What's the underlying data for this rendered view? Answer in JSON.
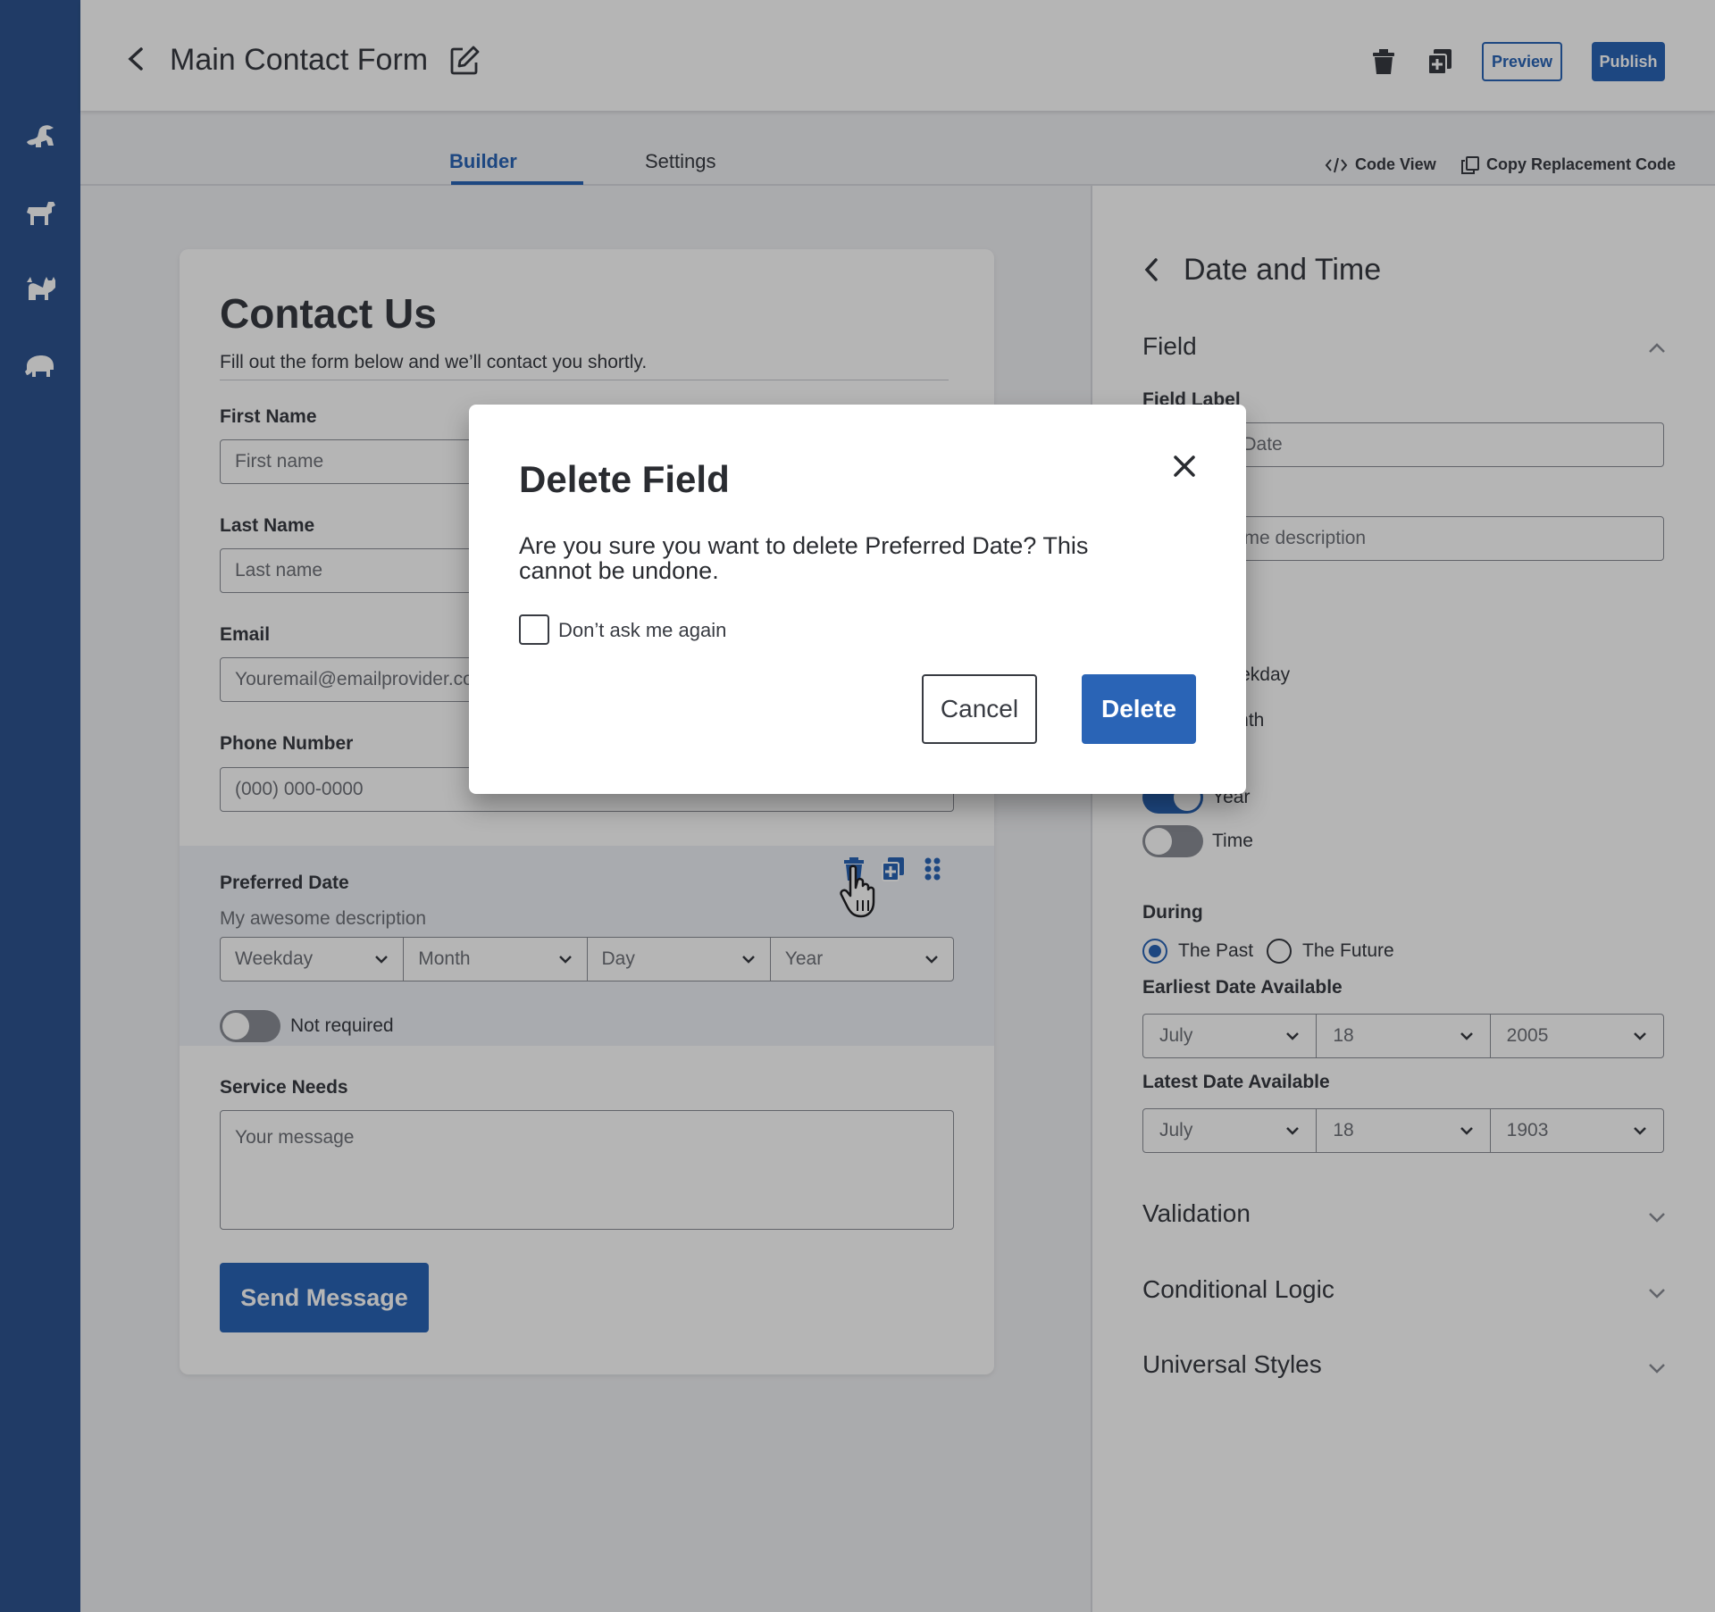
{
  "header": {
    "title": "Main Contact Form",
    "preview_label": "Preview",
    "publish_label": "Publish"
  },
  "tabs": [
    {
      "label": "Builder",
      "active": true
    },
    {
      "label": "Settings",
      "active": false
    }
  ],
  "toolbar": {
    "code_view_label": "Code View",
    "copy_code_label": "Copy Replacement Code"
  },
  "sidebar": {
    "icons": [
      "dinosaur-icon",
      "dog-icon",
      "cat-icon",
      "elephant-icon"
    ]
  },
  "form": {
    "title": "Contact Us",
    "subtitle": "Fill out the form below and we’ll contact you shortly.",
    "fields": [
      {
        "label": "First Name",
        "placeholder": "First name"
      },
      {
        "label": "Last Name",
        "placeholder": "Last name"
      },
      {
        "label": "Email",
        "placeholder": "Youremail@emailprovider.com"
      },
      {
        "label": "Phone Number",
        "placeholder": "(000) 000-0000"
      }
    ],
    "preferred_date": {
      "label": "Preferred Date",
      "description": "My awesome description",
      "selects": [
        "Weekday",
        "Month",
        "Day",
        "Year"
      ],
      "required_toggle_label": "Not required",
      "required": false
    },
    "service_needs": {
      "label": "Service Needs",
      "placeholder": "Your message"
    },
    "submit_label": "Send Message"
  },
  "right_panel": {
    "title": "Date and Time",
    "field_section": "Field",
    "field_label_label": "Field Label",
    "field_label_value": "Preferred Date",
    "description_value": "My awesome description",
    "toggle_weekday": "Weekday",
    "toggle_month": "Month",
    "toggle_year": "Year",
    "toggle_time": "Time",
    "year_on": true,
    "time_on": false,
    "during_label": "During",
    "during_options": [
      "The Past",
      "The Future"
    ],
    "during_selected": "The Past",
    "earliest_label": "Earliest Date Available",
    "earliest": [
      "July",
      "18",
      "2005"
    ],
    "latest_label": "Latest Date Available",
    "latest": [
      "July",
      "18",
      "1903"
    ],
    "sections": [
      "Validation",
      "Conditional Logic",
      "Universal Styles"
    ]
  },
  "modal": {
    "title": "Delete Field",
    "message": "Are you sure you want to delete Preferred Date? This cannot be undone.",
    "checkbox_label": "Don’t ask me again",
    "checked": false,
    "cancel_label": "Cancel",
    "delete_label": "Delete"
  },
  "colors": {
    "sidebar": "#2e5490",
    "accent": "#2a64b6",
    "text": "#383b42"
  }
}
